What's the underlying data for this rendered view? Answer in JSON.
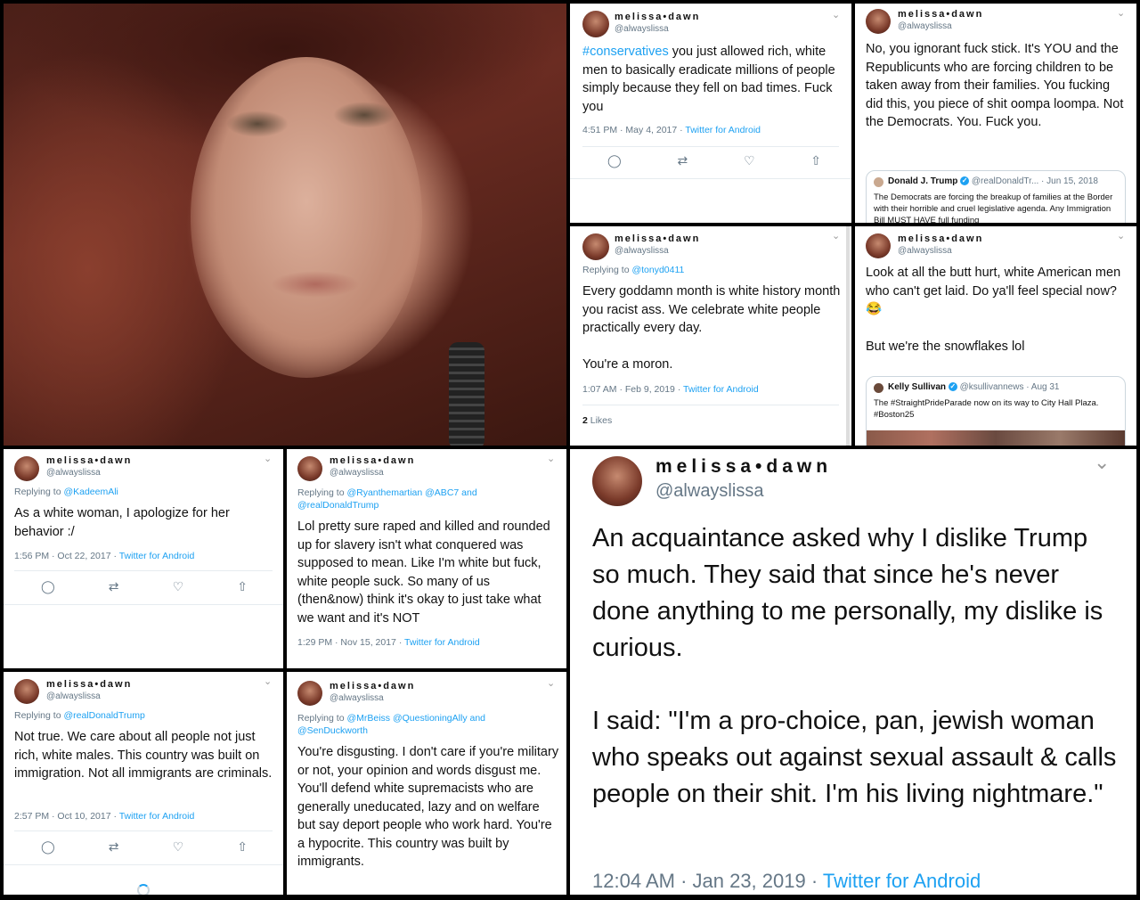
{
  "user": {
    "display_name": "melissa•dawn",
    "handle": "@alwayslissa"
  },
  "icons": {
    "reply": "reply-icon",
    "retweet": "retweet-icon",
    "like": "like-icon",
    "share": "share-icon",
    "chevron": "chevron-down-icon"
  },
  "colors": {
    "link": "#1da1f2",
    "meta": "#657786",
    "text": "#111111"
  },
  "tweets": {
    "t1": {
      "hashtag": "#conservatives",
      "text": " you just allowed rich, white men to basically eradicate millions of people simply because they fell on bad times. Fuck you",
      "time": "4:51 PM · May 4, 2017 · ",
      "source": "Twitter for Android"
    },
    "t2": {
      "text": "No, you ignorant fuck stick. It's YOU and the Republicunts who are forcing children to be taken away from their families. You fucking did this, you piece of shit oompa loompa. Not the Democrats. You. Fuck you.",
      "quote": {
        "name": "Donald J. Trump",
        "handle": "@realDonaldTr... · Jun 15, 2018",
        "text": "The Democrats are forcing the breakup of families at the Border with their horrible and cruel legislative agenda. Any Immigration Bill MUST HAVE full funding"
      }
    },
    "t3": {
      "reply_prefix": "Replying to ",
      "reply_to": "@tonyd0411",
      "text": "Every goddamn month is white history month you racist ass. We celebrate white people practically every day.",
      "text2": "You're a moron.",
      "time": "1:07 AM · Feb 9, 2019 · ",
      "source": "Twitter for Android",
      "likes_count": "2",
      "likes_label": " Likes"
    },
    "t4": {
      "text": "Look at all the butt hurt, white American men who can't get laid. Do ya'll feel special now? 😂",
      "text2": "But we're the snowflakes lol",
      "quote": {
        "name": "Kelly Sullivan",
        "handle": "@ksullivannews · Aug 31",
        "text": "The #StraightPrideParade now on its way to City Hall Plaza. #Boston25"
      }
    },
    "t5": {
      "reply_prefix": "Replying to ",
      "reply_to": "@KadeemAli",
      "text": "As a white woman, I apologize for her behavior :/",
      "time": "1:56 PM · Oct 22, 2017 · ",
      "source": "Twitter for Android"
    },
    "t6": {
      "reply_prefix": "Replying to ",
      "reply_to": "@Ryanthemartian @ABC7 and @realDonaldTrump",
      "text": "Lol pretty sure raped and killed and rounded up for slavery isn't what conquered was supposed to mean. Like I'm white but fuck, white people suck. So many of us (then&now) think it's okay to just take what we want and it's NOT",
      "time": "1:29 PM · Nov 15, 2017 · ",
      "source": "Twitter for Android"
    },
    "t7": {
      "reply_prefix": "Replying to ",
      "reply_to": "@realDonaldTrump",
      "text": "Not true. We care about all people not just rich, white males. This country was built on immigration. Not all immigrants are criminals.",
      "time": "2:57 PM · Oct 10, 2017 · ",
      "source": "Twitter for Android"
    },
    "t8": {
      "reply_prefix": "Replying to ",
      "reply_to": "@MrBeiss @QuestioningAlly and @SenDuckworth",
      "text": "You're disgusting. I don't care if you're military or not, your opinion and words disgust me. You'll defend white supremacists who are generally uneducated, lazy and on welfare but say deport people who work hard. You're a hypocrite. This country was built by immigrants."
    },
    "t9": {
      "text": "An acquaintance asked why I dislike Trump so much. They said that since he's never done anything to me personally, my dislike is curious.",
      "text2": "I said: \"I'm a pro-choice, pan, jewish woman who speaks out against sexual assault & calls people on their shit. I'm his living nightmare.\"",
      "time": "12:04 AM · Jan 23, 2019 · ",
      "source": "Twitter for Android"
    }
  }
}
